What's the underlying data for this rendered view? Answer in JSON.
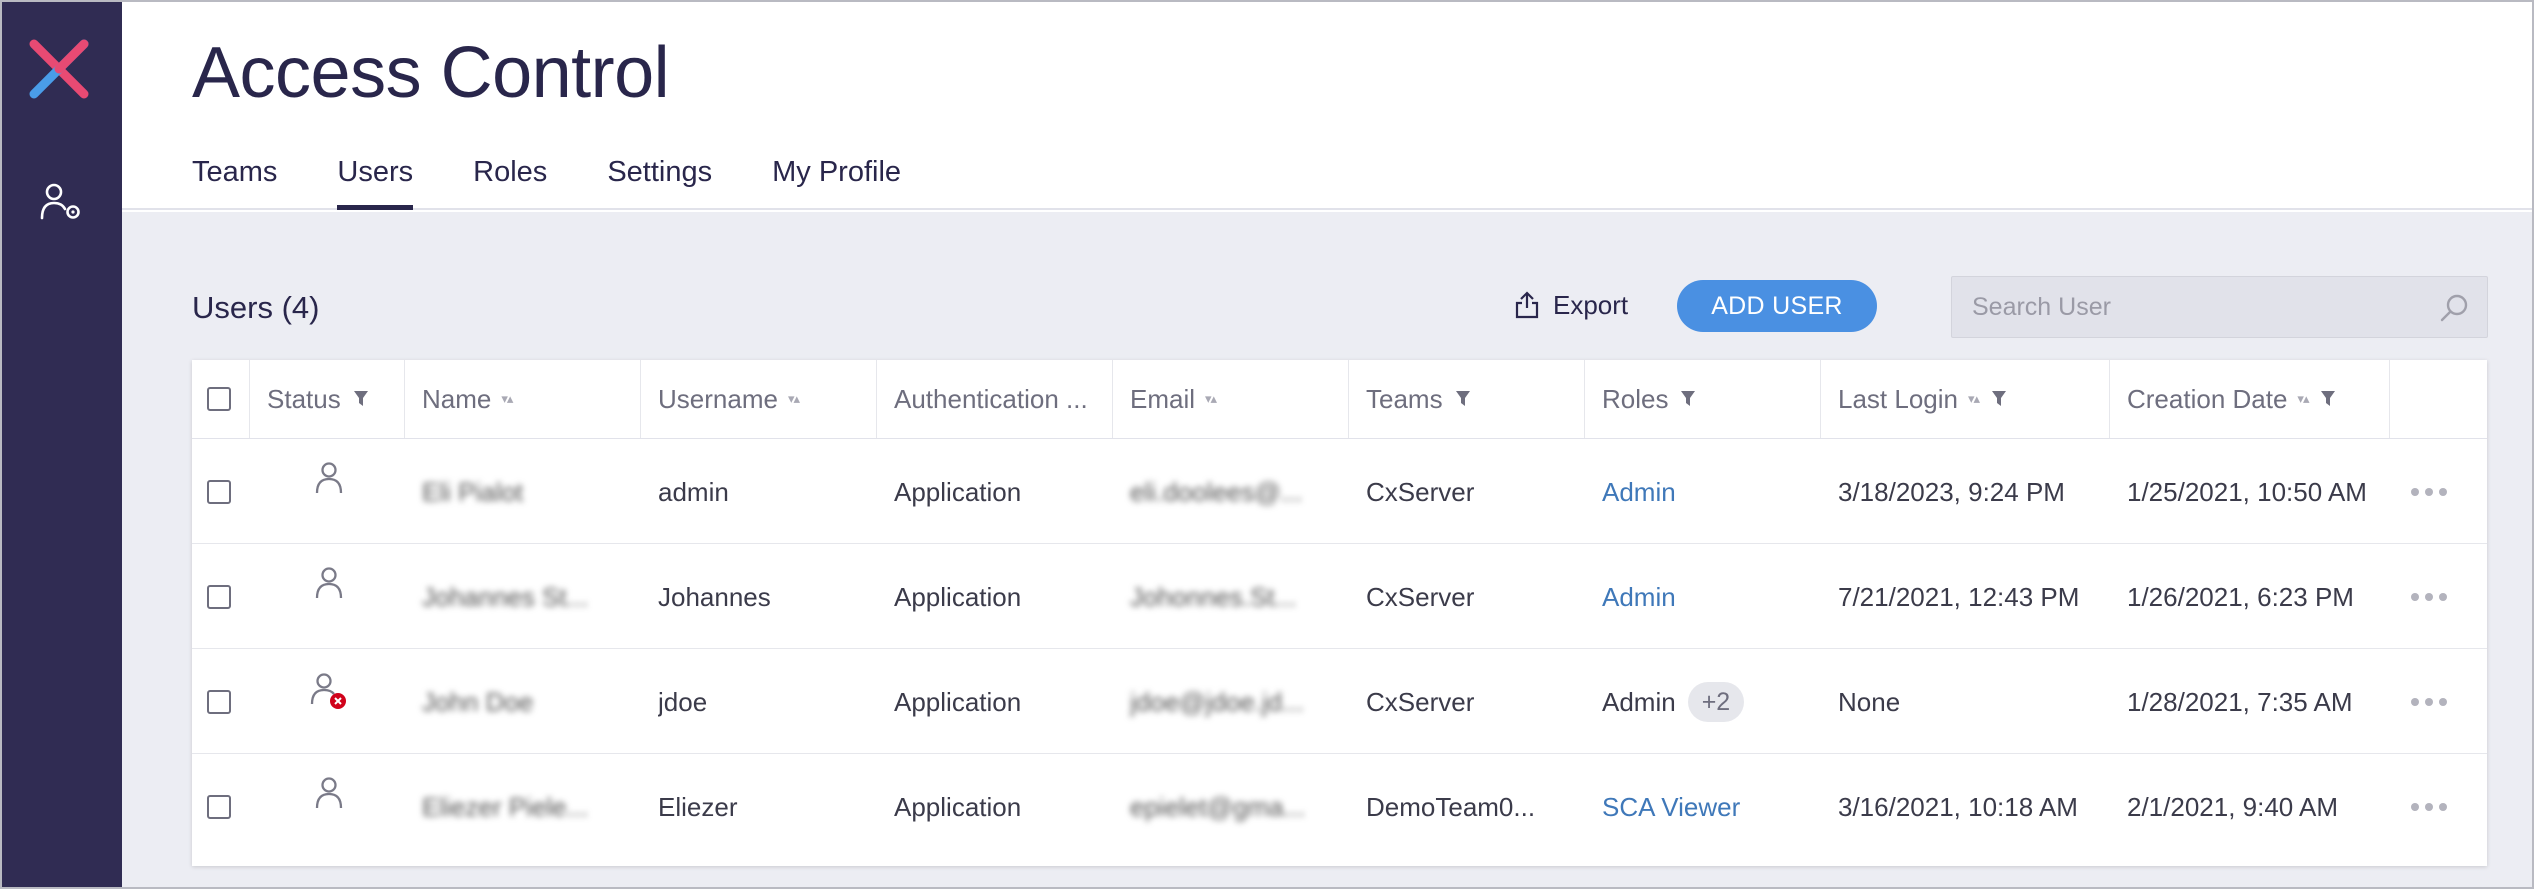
{
  "app": {
    "title": "Access Control",
    "accent": "#4a90e2",
    "sidebar_color": "#302c53"
  },
  "sidebar": {
    "icons": [
      "app-logo-icon",
      "user-settings-icon"
    ]
  },
  "tabs": [
    {
      "label": "Teams",
      "active": false
    },
    {
      "label": "Users",
      "active": true
    },
    {
      "label": "Roles",
      "active": false
    },
    {
      "label": "Settings",
      "active": false
    },
    {
      "label": "My Profile",
      "active": false
    }
  ],
  "toolbar": {
    "users_count_label": "Users (4)",
    "export_label": "Export",
    "add_user_label": "ADD USER",
    "search_placeholder": "Search User"
  },
  "table": {
    "columns": [
      "Status",
      "Name",
      "Username",
      "Authentication ...",
      "Email",
      "Teams",
      "Roles",
      "Last Login",
      "Creation Date"
    ],
    "rows": [
      {
        "status": "active",
        "name": "Eli Pialot",
        "username": "admin",
        "auth": "Application",
        "email": "eli.doolees@...",
        "teams": "CxServer",
        "role": "Admin",
        "role_link": true,
        "role_extra": "",
        "last_login": "3/18/2023, 9:24 PM",
        "created": "1/25/2021, 10:50 AM"
      },
      {
        "status": "active",
        "name": "Johannes St...",
        "username": "Johannes",
        "auth": "Application",
        "email": "Johonnes.St...",
        "teams": "CxServer",
        "role": "Admin",
        "role_link": true,
        "role_extra": "",
        "last_login": "7/21/2021, 12:43 PM",
        "created": "1/26/2021, 6:23 PM"
      },
      {
        "status": "inactive",
        "name": "John Doe",
        "username": "jdoe",
        "auth": "Application",
        "email": "jdoe@jdoe.jd...",
        "teams": "CxServer",
        "role": "Admin",
        "role_link": false,
        "role_extra": "+2",
        "last_login": "None",
        "created": "1/28/2021, 7:35 AM"
      },
      {
        "status": "active",
        "name": "Eliezer Piele...",
        "username": "Eliezer",
        "auth": "Application",
        "email": "epielet@gma...",
        "teams": "DemoTeam0...",
        "role": "SCA Viewer",
        "role_link": true,
        "role_extra": "",
        "last_login": "3/16/2021, 10:18 AM",
        "created": "2/1/2021, 9:40 AM"
      }
    ]
  }
}
